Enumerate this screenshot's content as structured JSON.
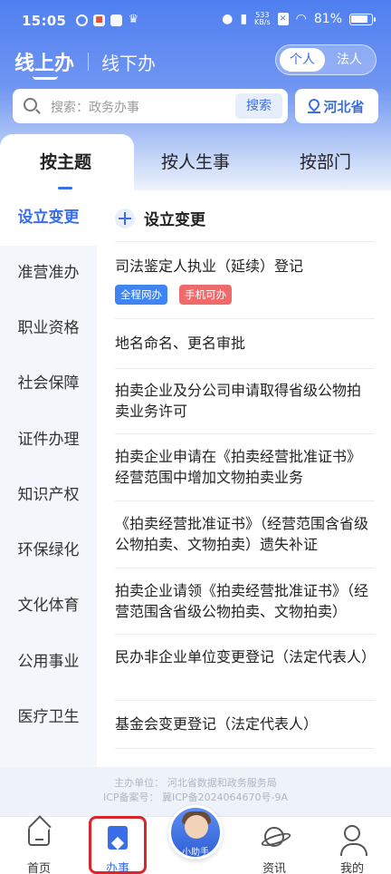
{
  "status_bar": {
    "time": "15:05",
    "net_speed_value": "533",
    "net_speed_unit": "KB/s",
    "battery": "81%"
  },
  "mode": {
    "online": "线上办",
    "offline": "线下办",
    "persona_individual": "个人",
    "persona_legal": "法人"
  },
  "search": {
    "placeholder": "搜索：政务办事",
    "button": "搜索"
  },
  "region": "河北省",
  "tabs": [
    "按主题",
    "按人生事",
    "按部门"
  ],
  "sidebar": [
    "设立变更",
    "准营准办",
    "职业资格",
    "社会保障",
    "证件办理",
    "知识产权",
    "环保绿化",
    "文化体育",
    "公用事业",
    "医疗卫生"
  ],
  "section_title": "设立变更",
  "items": [
    {
      "title": "司法鉴定人执业（延续）登记",
      "tags": [
        "全程网办",
        "手机可办"
      ]
    },
    {
      "title": "地名命名、更名审批"
    },
    {
      "title": "拍卖企业及分公司申请取得省级公物拍卖业务许可"
    },
    {
      "title": "拍卖企业申请在《拍卖经营批准证书》经营范围中增加文物拍卖业务"
    },
    {
      "title": "《拍卖经营批准证书》（经营范围含省级公物拍卖、文物拍卖）遗失补证"
    },
    {
      "title": "拍卖企业请领《拍卖经营批准证书》（经营范围含省级公物拍卖、文物拍卖）"
    },
    {
      "title": "民办非企业单位变更登记（法定代表人）"
    },
    {
      "title": "基金会变更登记（法定代表人）"
    }
  ],
  "footer": {
    "line1": "主办单位：  河北省数据和政务服务局",
    "line2": "ICP备案号：  冀ICP备2024064670号-9A"
  },
  "nav": {
    "home": "首页",
    "service": "办事",
    "helper": "小助手",
    "news": "资讯",
    "me": "我的"
  },
  "colors": {
    "accent": "#3a6ee8",
    "tag_blue": "#3f84f2",
    "tag_red": "#ef6b6b",
    "highlight": "#d8262b"
  }
}
